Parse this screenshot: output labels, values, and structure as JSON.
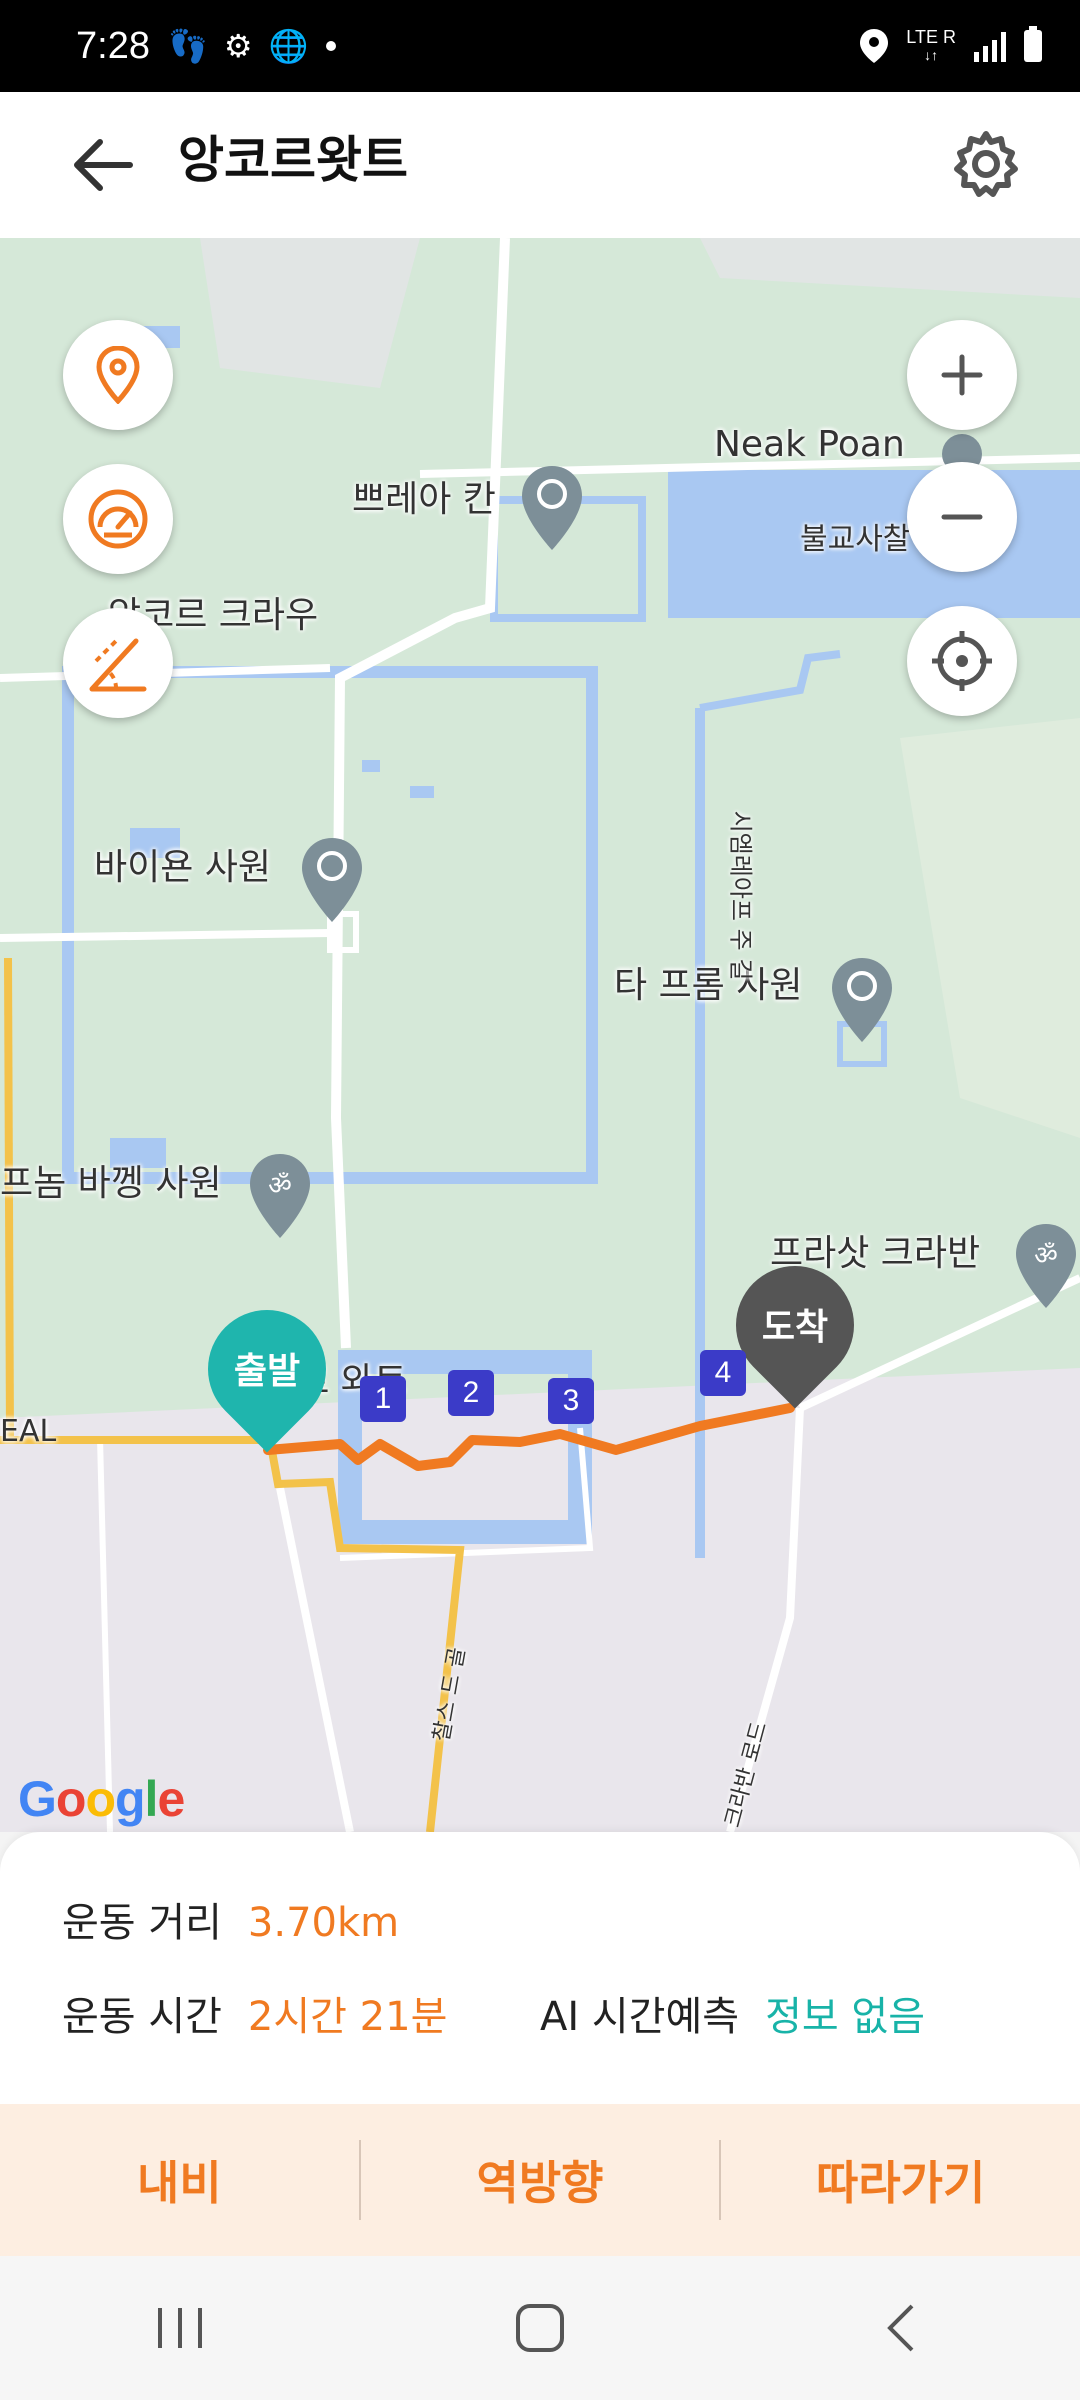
{
  "status_bar": {
    "time": "7:28",
    "network": "LTE",
    "roaming": "R"
  },
  "app_bar": {
    "title": "앙코르왓트",
    "back_icon": "arrow-left-icon",
    "settings_icon": "gear-icon"
  },
  "map": {
    "labels": {
      "preah_khan": "쁘레아 칸",
      "neak_poan": "Neak Poan",
      "buddhist_temple": "불교사찰",
      "angkor_thom": "앙코르 크라우",
      "bayon": "바이욘 사원",
      "ta_prohm": "타 프롬 사원",
      "baphuon": "프놈 바껭 사원",
      "prasat_kravan": "프라삿 크라반",
      "angkor_wat": "앙코르 와트",
      "road_siem": "시엠레아프 주 길",
      "road_charles": "찰스 드 골",
      "road_right": "크라반 로드",
      "road_left_edge": "EAL"
    },
    "markers": {
      "start": "출발",
      "end": "도착",
      "waypoints": [
        "1",
        "2",
        "3",
        "4"
      ]
    },
    "controls": {
      "location_pin_icon": "location-pin-icon",
      "speedometer_icon": "speedometer-icon",
      "elevation_icon": "elevation-icon",
      "zoom_in_icon": "plus-icon",
      "zoom_out_icon": "minus-icon",
      "locate_icon": "crosshair-icon"
    },
    "attribution": "Google"
  },
  "summary": {
    "distance_label": "운동 거리",
    "distance_value": "3.70km",
    "time_label": "운동 시간",
    "time_value": "2시간 21분",
    "ai_label": "AI 시간예측",
    "ai_value": "정보 없음"
  },
  "actions": {
    "navigate": "내비",
    "reverse": "역방향",
    "follow": "따라가기"
  },
  "colors": {
    "accent_orange": "#f07a21",
    "accent_teal": "#18b3a8",
    "waypoint_blue": "#3b3bc8"
  }
}
